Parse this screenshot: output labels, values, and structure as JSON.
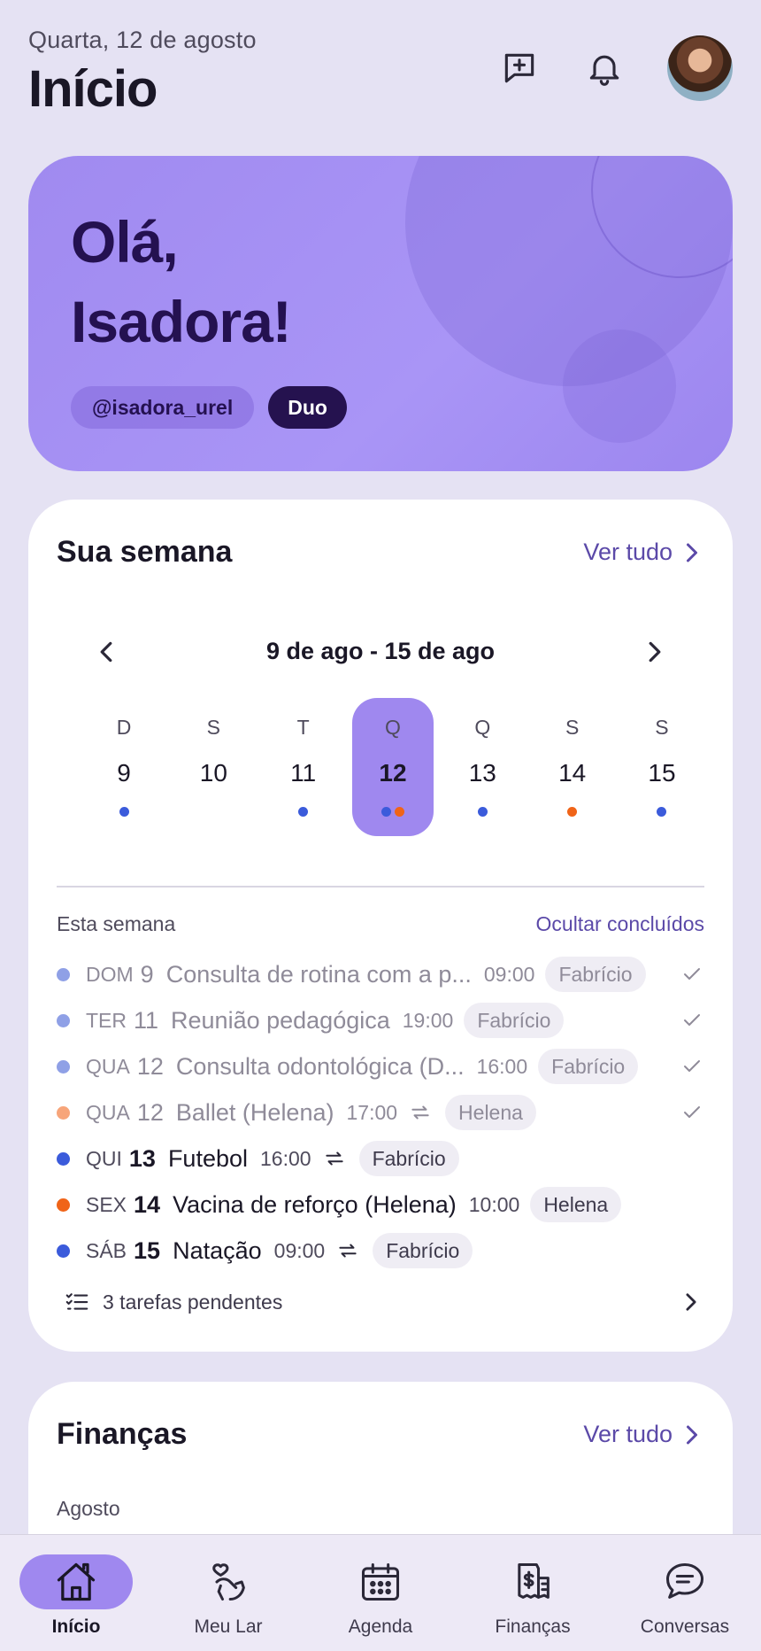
{
  "header": {
    "date": "Quarta, 12 de agosto",
    "title": "Início",
    "icons": [
      "chat-plus-icon",
      "bell-icon"
    ]
  },
  "hero": {
    "greeting_line1": "Olá,",
    "greeting_line2": "Isadora!",
    "username": "@isadora_urel",
    "plan": "Duo"
  },
  "week": {
    "title": "Sua semana",
    "see_all": "Ver tudo",
    "range": "9 de ago - 15 de ago",
    "days": [
      {
        "wd": "D",
        "dn": "9",
        "dots": [
          "#3b5bdb"
        ],
        "selected": false
      },
      {
        "wd": "S",
        "dn": "10",
        "dots": [],
        "selected": false
      },
      {
        "wd": "T",
        "dn": "11",
        "dots": [
          "#3b5bdb"
        ],
        "selected": false
      },
      {
        "wd": "Q",
        "dn": "12",
        "dots": [
          "#3b5bdb",
          "#f06418"
        ],
        "selected": true
      },
      {
        "wd": "Q",
        "dn": "13",
        "dots": [
          "#3b5bdb"
        ],
        "selected": false
      },
      {
        "wd": "S",
        "dn": "14",
        "dots": [
          "#f06418"
        ],
        "selected": false
      },
      {
        "wd": "S",
        "dn": "15",
        "dots": [
          "#3b5bdb"
        ],
        "selected": false
      }
    ],
    "section_label": "Esta semana",
    "hide_done": "Ocultar concluídos",
    "events": [
      {
        "wd": "DOM",
        "dn": "9",
        "title": "Consulta de rotina com a p...",
        "time": "09:00",
        "tag": "Fabrício",
        "color": "#8fa0e6",
        "repeat": false,
        "done": true
      },
      {
        "wd": "TER",
        "dn": "11",
        "title": "Reunião pedagógica",
        "time": "19:00",
        "tag": "Fabrício",
        "color": "#8fa0e6",
        "repeat": false,
        "done": true
      },
      {
        "wd": "QUA",
        "dn": "12",
        "title": "Consulta odontológica (D...",
        "time": "16:00",
        "tag": "Fabrício",
        "color": "#8fa0e6",
        "repeat": false,
        "done": true
      },
      {
        "wd": "QUA",
        "dn": "12",
        "title": "Ballet (Helena)",
        "time": "17:00",
        "tag": "Helena",
        "color": "#f7a57a",
        "repeat": true,
        "done": true
      },
      {
        "wd": "QUI",
        "dn": "13",
        "title": "Futebol",
        "time": "16:00",
        "tag": "Fabrício",
        "color": "#3b5bdb",
        "repeat": true,
        "done": false
      },
      {
        "wd": "SEX",
        "dn": "14",
        "title": "Vacina de reforço (Helena)",
        "time": "10:00",
        "tag": "Helena",
        "color": "#f06418",
        "repeat": false,
        "done": false
      },
      {
        "wd": "SÁB",
        "dn": "15",
        "title": "Natação",
        "time": "09:00",
        "tag": "Fabrício",
        "color": "#3b5bdb",
        "repeat": true,
        "done": false
      }
    ],
    "pending": "3 tarefas pendentes"
  },
  "finance": {
    "title": "Finanças",
    "see_all": "Ver tudo",
    "month": "Agosto"
  },
  "nav": [
    {
      "label": "Início",
      "icon": "home-icon",
      "active": true
    },
    {
      "label": "Meu Lar",
      "icon": "heart-hand-icon",
      "active": false
    },
    {
      "label": "Agenda",
      "icon": "calendar-icon",
      "active": false
    },
    {
      "label": "Finanças",
      "icon": "receipt-icon",
      "active": false
    },
    {
      "label": "Conversas",
      "icon": "chat-icon",
      "active": false
    }
  ]
}
